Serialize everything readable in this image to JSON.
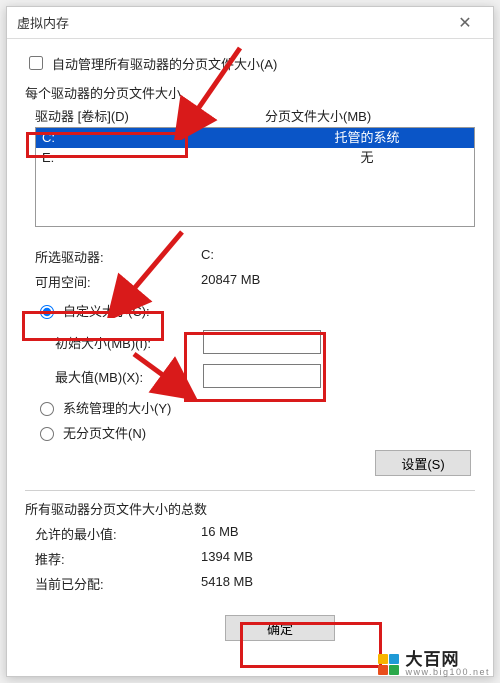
{
  "window": {
    "title": "虚拟内存"
  },
  "auto_manage_label": "自动管理所有驱动器的分页文件大小(A)",
  "per_drive_label": "每个驱动器的分页文件大小",
  "headers": {
    "drive": "驱动器 [卷标](D)",
    "size": "分页文件大小(MB)"
  },
  "drives": [
    {
      "letter": "C:",
      "status": "托管的系统",
      "selected": true
    },
    {
      "letter": "E:",
      "status": "无",
      "selected": false
    }
  ],
  "selected": {
    "drive_label": "所选驱动器:",
    "drive_value": "C:",
    "space_label": "可用空间:",
    "space_value": "20847 MB"
  },
  "radios": {
    "custom": "自定义大小(C):",
    "system": "系统管理的大小(Y)",
    "none": "无分页文件(N)"
  },
  "custom": {
    "initial_label": "初始大小(MB)(I):",
    "initial_value": "",
    "max_label": "最大值(MB)(X):",
    "max_value": ""
  },
  "buttons": {
    "set": "设置(S)",
    "ok": "确定"
  },
  "totals": {
    "heading": "所有驱动器分页文件大小的总数",
    "min_label": "允许的最小值:",
    "min_value": "16 MB",
    "rec_label": "推荐:",
    "rec_value": "1394 MB",
    "cur_label": "当前已分配:",
    "cur_value": "5418 MB"
  },
  "brand": {
    "name": "大百网",
    "url": "www.big100.net"
  },
  "colors": {
    "accent": "#0a55c7",
    "highlight": "#d91a1a"
  }
}
